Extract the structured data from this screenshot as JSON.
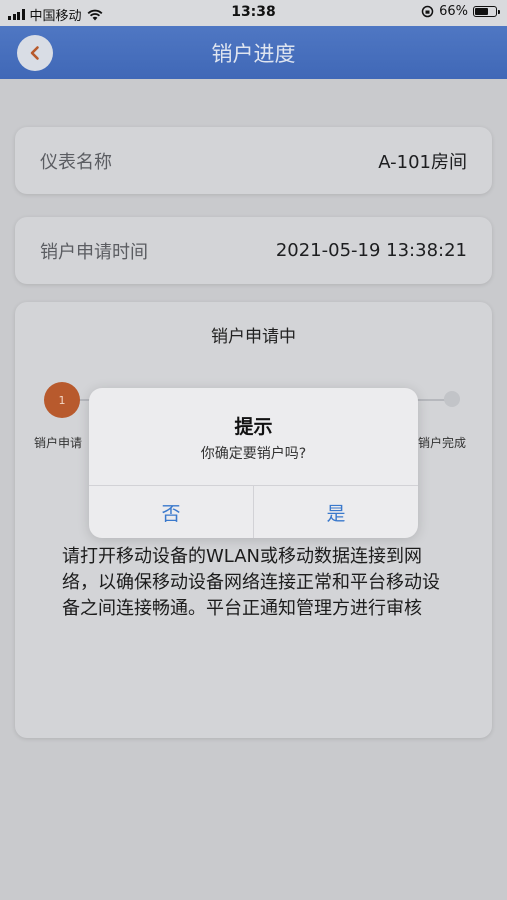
{
  "status_bar": {
    "carrier": "中国移动",
    "time": "13:38",
    "battery_text": "66%",
    "battery_level": 0.66
  },
  "header": {
    "title": "销户进度",
    "back_icon": "chevron-left-icon"
  },
  "info": {
    "meter_label": "仪表名称",
    "meter_value": "A-101房间",
    "apply_time_label": "销户申请时间",
    "apply_time_value": "2021-05-19 13:38:21"
  },
  "progress": {
    "status_title": "销户申请中",
    "step1_number": "1",
    "step1_label": "销户申请",
    "step_last_label": "销户完成",
    "notice": "请打开移动设备的WLAN或移动数据连接到网络，以确保移动设备网络连接正常和平台移动设备之间连接畅通。平台正通知管理方进行审核"
  },
  "dialog": {
    "title": "提示",
    "message": "你确定要销户吗?",
    "cancel_label": "否",
    "confirm_label": "是"
  },
  "colors": {
    "header_bg": "#4a72c0",
    "step_active": "#b85a2d",
    "dialog_button_text": "#3a79cc"
  }
}
